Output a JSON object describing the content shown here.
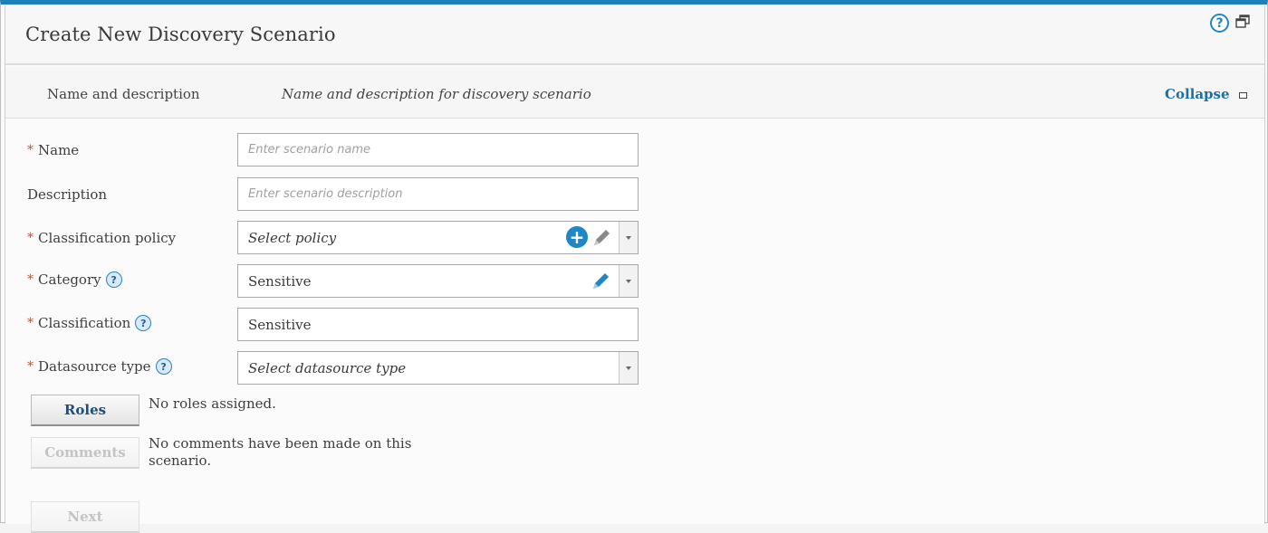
{
  "header": {
    "title": "Create New Discovery Scenario",
    "help_icon": "question-circle-icon",
    "restore_icon": "window-restore-icon"
  },
  "section": {
    "label": "Name and description",
    "description": "Name and description for discovery scenario",
    "collapse_label": "Collapse",
    "collapse_icon": "minimize-square-icon"
  },
  "form": {
    "required_marker": "*",
    "help_glyph": "?",
    "name": {
      "label": "Name",
      "required": true,
      "value": "",
      "placeholder": "Enter scenario name"
    },
    "description": {
      "label": "Description",
      "required": false,
      "value": "",
      "placeholder": "Enter scenario description"
    },
    "classification_policy": {
      "label": "Classification policy",
      "required": true,
      "value": "Select policy",
      "icons": [
        "add-circle-icon",
        "pencil-icon",
        "chevron-down-icon"
      ]
    },
    "category": {
      "label": "Category",
      "required": true,
      "value": "Sensitive",
      "icons": [
        "help-icon",
        "pencil-icon",
        "chevron-down-icon"
      ]
    },
    "classification": {
      "label": "Classification",
      "required": true,
      "value": "Sensitive",
      "icons": [
        "help-icon"
      ]
    },
    "datasource_type": {
      "label": "Datasource type",
      "required": true,
      "value": "Select datasource type",
      "icons": [
        "help-icon",
        "chevron-down-icon"
      ]
    }
  },
  "buttons": {
    "roles": {
      "label": "Roles",
      "note": "No roles assigned."
    },
    "comments": {
      "label": "Comments",
      "note": "No comments have been made on this scenario.",
      "disabled": true
    },
    "next": {
      "label": "Next",
      "disabled": true
    }
  },
  "colors": {
    "accent": "#1f86c8",
    "top_border": "#1f7fb8",
    "link": "#1d6fa8",
    "required": "#d9482b",
    "button_text": "#1e4f7a"
  }
}
